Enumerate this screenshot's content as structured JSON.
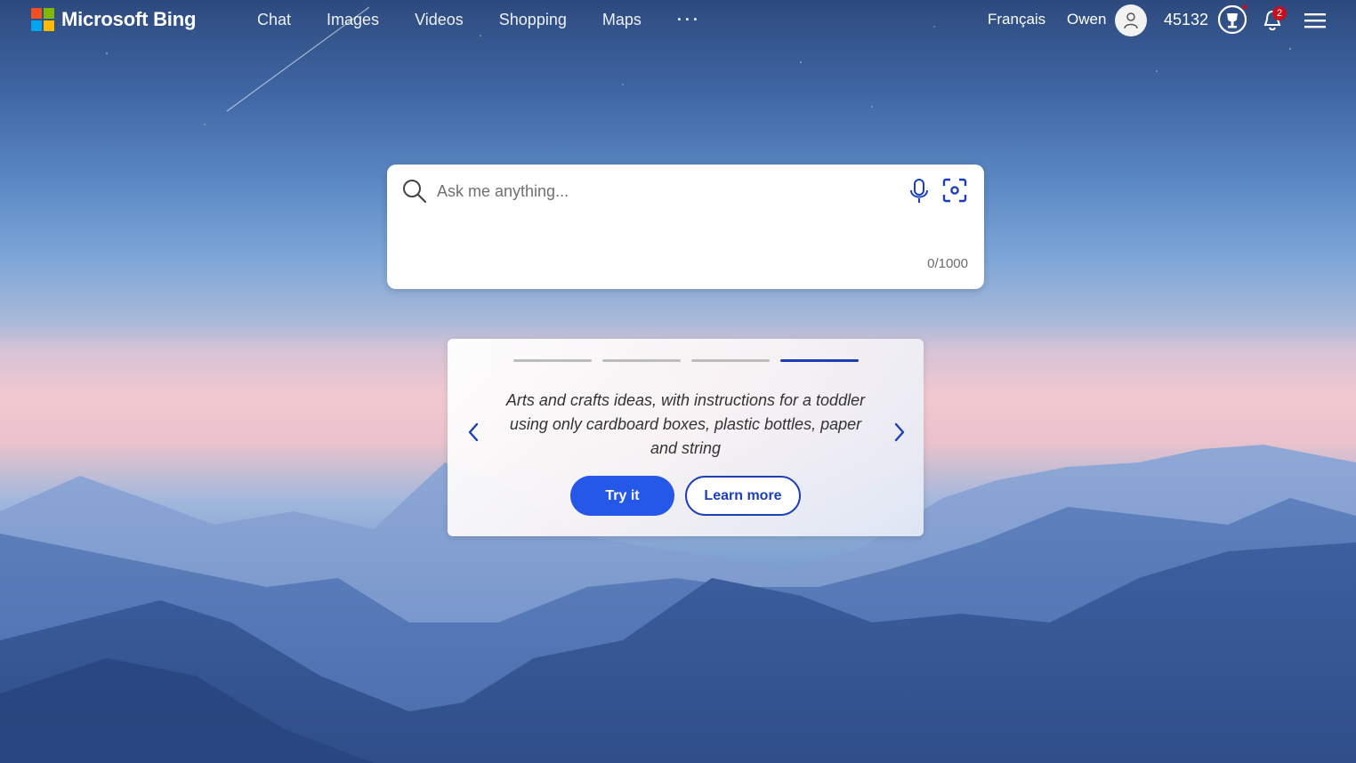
{
  "brand": {
    "name": "Microsoft Bing",
    "colors": [
      "#f25022",
      "#7fba00",
      "#00a4ef",
      "#ffb900"
    ]
  },
  "nav": {
    "items": [
      {
        "label": "Chat"
      },
      {
        "label": "Images"
      },
      {
        "label": "Videos"
      },
      {
        "label": "Shopping"
      },
      {
        "label": "Maps"
      }
    ],
    "more_label": "···"
  },
  "header": {
    "language": "Français",
    "user_name": "Owen",
    "points": "45132",
    "notification_count": "2"
  },
  "search": {
    "placeholder": "Ask me anything...",
    "value": "",
    "char_counter": "0/1000"
  },
  "carousel": {
    "active_index": 3,
    "prompt": "Arts and crafts ideas, with instructions for a toddler using only cardboard boxes, plastic bottles, paper and string",
    "try_label": "Try it",
    "learn_label": "Learn more"
  },
  "icons": {
    "search": "search-icon",
    "mic": "microphone-icon",
    "visual": "visual-search-icon",
    "avatar": "user-avatar-icon",
    "trophy": "rewards-trophy-icon",
    "bell": "bell-icon",
    "menu": "hamburger-menu-icon",
    "prev": "chevron-left-icon",
    "next": "chevron-right-icon"
  },
  "accent_color": "#2557e8"
}
